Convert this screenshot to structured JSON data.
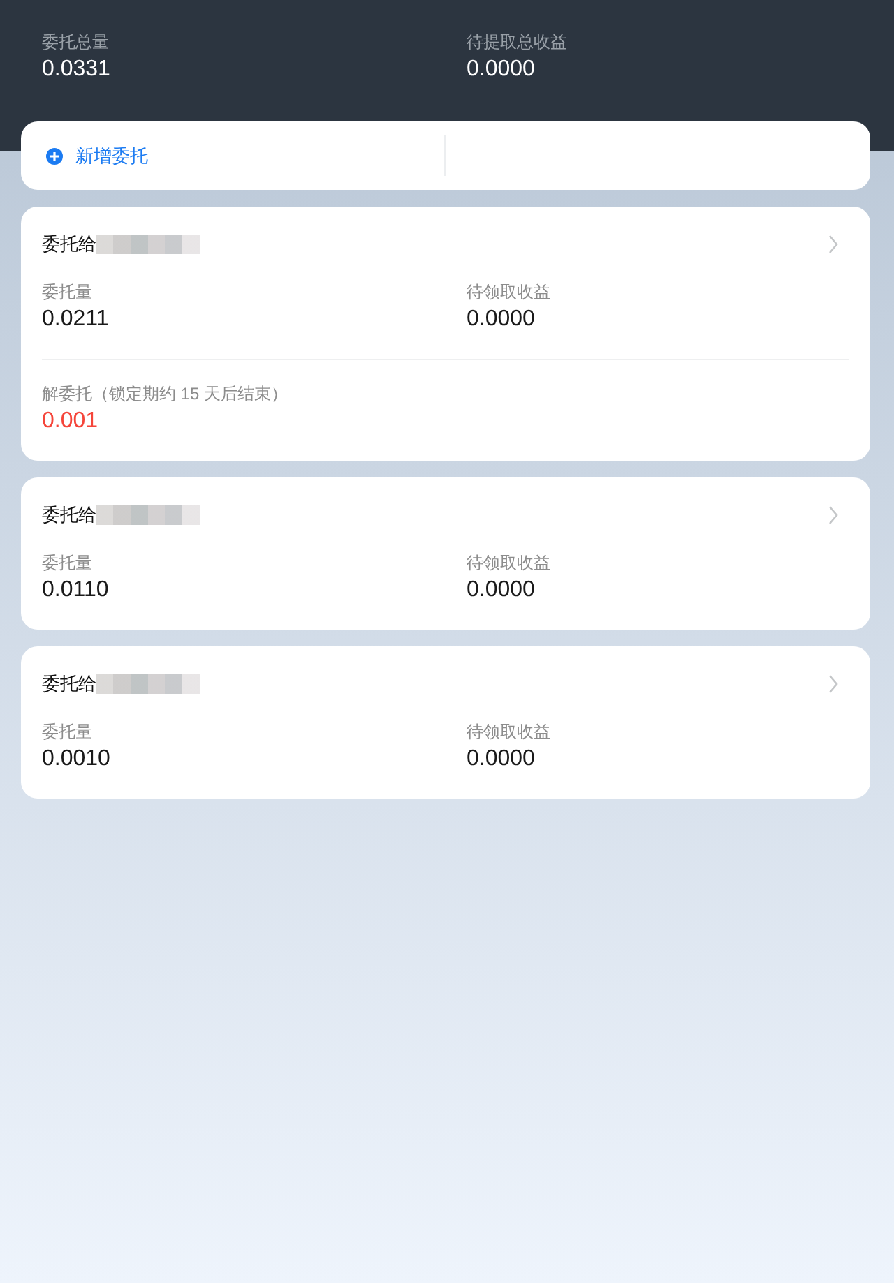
{
  "summary": [
    {
      "label": "委托总量",
      "value": "0.0331"
    },
    {
      "label": "待提取总收益",
      "value": "0.0000"
    }
  ],
  "add_delegation": {
    "label": "新增委托"
  },
  "delegations": [
    {
      "title": "委托给",
      "stats": [
        {
          "label": "委托量",
          "value": "0.0211"
        },
        {
          "label": "待领取收益",
          "value": "0.0000"
        }
      ],
      "unbonding": {
        "label": "解委托（锁定期约 15 天后结束）",
        "value": "0.001"
      }
    },
    {
      "title": "委托给",
      "stats": [
        {
          "label": "委托量",
          "value": "0.0110"
        },
        {
          "label": "待领取收益",
          "value": "0.0000"
        }
      ]
    },
    {
      "title": "委托给",
      "stats": [
        {
          "label": "委托量",
          "value": "0.0010"
        },
        {
          "label": "待领取收益",
          "value": "0.0000"
        }
      ]
    }
  ]
}
